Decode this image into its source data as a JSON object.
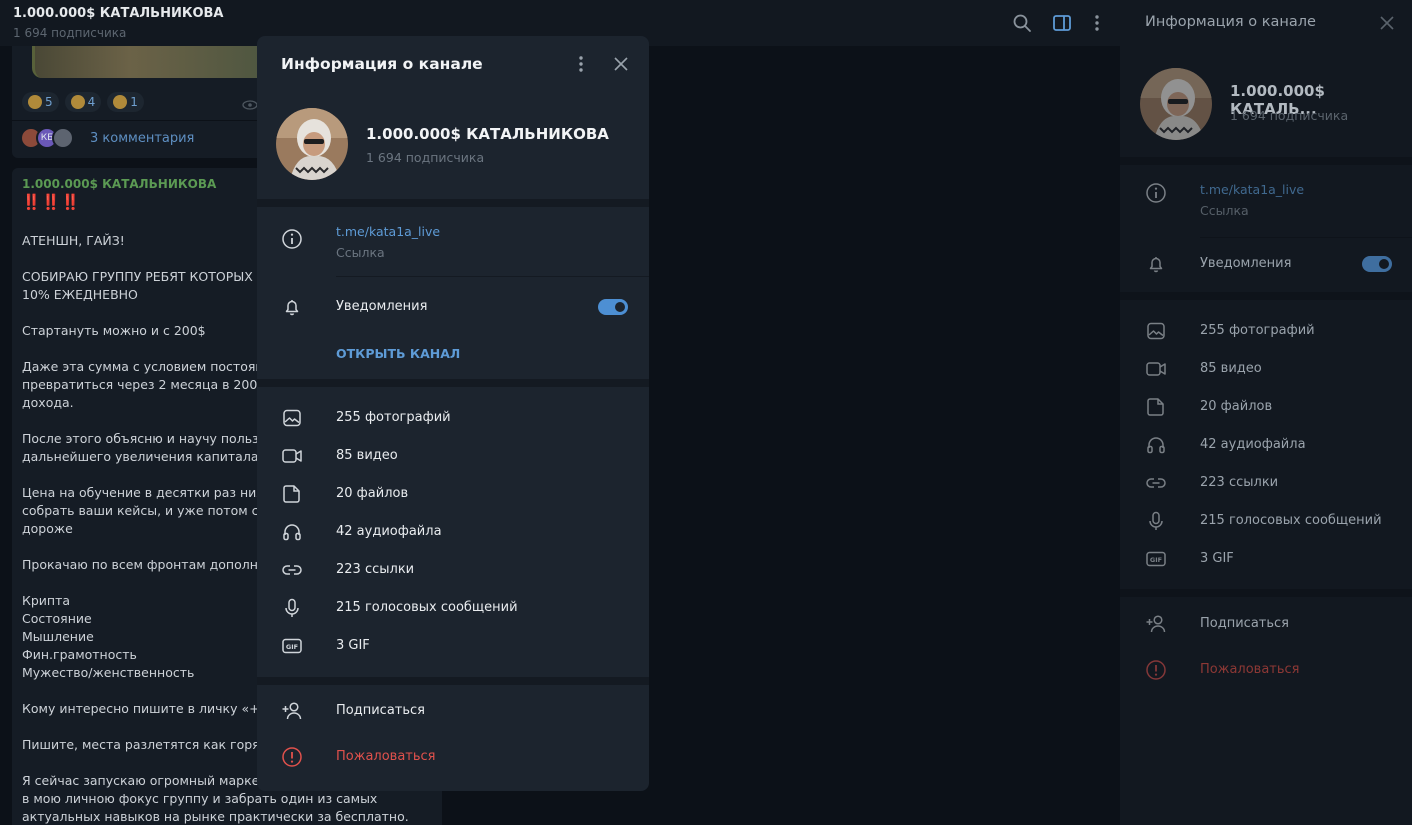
{
  "chat_header": {
    "title": "1.000.000$ КАТАЛЬНИКОВА",
    "subtitle": "1 694 подписчика",
    "icons": [
      "search-icon",
      "sidebar-toggle-icon",
      "more-vertical-icon"
    ]
  },
  "message_top": {
    "reactions": [
      {
        "emoji": "thumbs-up",
        "count": "5"
      },
      {
        "emoji": "grin",
        "count": "4"
      },
      {
        "emoji": "thinking",
        "count": "1"
      }
    ],
    "comment_avatars": [
      "",
      "КБ",
      ""
    ],
    "comments_label": "3 комментария"
  },
  "message_main": {
    "author": "1.000.000$ КАТАЛЬНИКОВА",
    "marks": "‼️‼️‼️",
    "body": "АТЕНШН, ГАЙЗ!\n\nСОБИРАЮ ГРУППУ РЕБЯТ КОТОРЫХ Н\n10% ЕЖЕДНЕВНО\n\nСтартануть можно и с 200$\n\nДаже эта сумма с условием постоянно\nпревратиться через 2 месяца в 2000$+\nдохода.\n\nПосле этого объясню и научу пользо\nдальнейшего увеличения капитала.\n\nЦена на обучение в десятки раз ниже\nсобрать ваши кейсы, и уже потом соб\nдороже\n\nПрокачаю по всем фронтам дополнит\n\nКрипта\nСостояние\nМышление\nФин.грамотность\nМужество/женственность\n\nКому интересно пишите в личку «+» @\n\nПишите, места разлетятся как горячи\n\nЯ сейчас запускаю огромный маркети\nв мою личнoю фокус группу и забрать один из самых\nактуальных навыков на рынке практически за бесплатно."
  },
  "modal": {
    "title": "Информация о канале",
    "channel_name": "1.000.000$ КАТАЛЬНИКОВА",
    "subscribers": "1 694 подписчика",
    "link": "t.me/kata1a_live",
    "link_caption": "Ссылка",
    "notifications_label": "Уведомления",
    "notifications_on": true,
    "open_channel": "ОТКРЫТЬ КАНАЛ",
    "media": [
      {
        "icon": "photo-icon",
        "label": "255 фотографий"
      },
      {
        "icon": "video-icon",
        "label": "85 видео"
      },
      {
        "icon": "file-icon",
        "label": "20 файлов"
      },
      {
        "icon": "headphones-icon",
        "label": "42 аудиофайла"
      },
      {
        "icon": "link-icon",
        "label": "223 ссылки"
      },
      {
        "icon": "microphone-icon",
        "label": "215 голосовых сообщений"
      },
      {
        "icon": "gif-icon",
        "label": "3 GIF"
      }
    ],
    "subscribe": "Подписаться",
    "report": "Пожаловаться"
  },
  "sidebar": {
    "title": "Информация о канале",
    "channel_name": "1.000.000$ КАТАЛЬ...",
    "subscribers": "1 694 подписчика",
    "link": "t.me/kata1a_live",
    "link_caption": "Ссылка",
    "notifications_label": "Уведомления",
    "notifications_on": true,
    "media": [
      {
        "icon": "photo-icon",
        "label": "255 фотографий"
      },
      {
        "icon": "video-icon",
        "label": "85 видео"
      },
      {
        "icon": "file-icon",
        "label": "20 файлов"
      },
      {
        "icon": "headphones-icon",
        "label": "42 аудиофайла"
      },
      {
        "icon": "link-icon",
        "label": "223 ссылки"
      },
      {
        "icon": "microphone-icon",
        "label": "215 голосовых сообщений"
      },
      {
        "icon": "gif-icon",
        "label": "3 GIF"
      }
    ],
    "subscribe": "Подписаться",
    "report": "Пожаловаться"
  },
  "colors": {
    "accent": "#5e9bd6",
    "danger": "#e0514c",
    "author": "#5b9a53",
    "modal_bg": "#1c242e"
  }
}
